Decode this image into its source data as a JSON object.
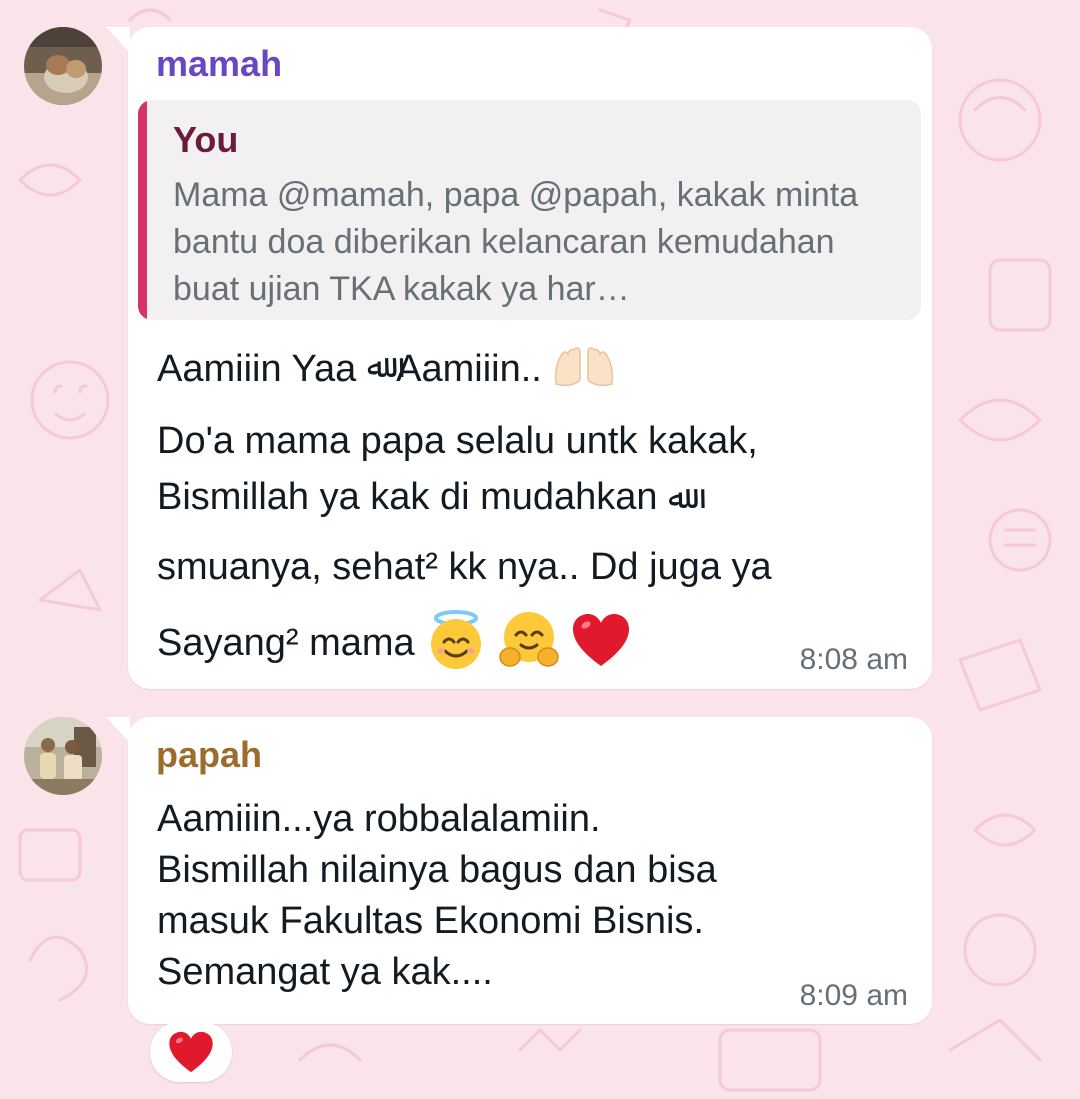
{
  "colors": {
    "wallpaper": "#fbe3ea",
    "bubble": "#ffffff",
    "mamah_name": "#6a47c2",
    "papah_name": "#9c6c2c",
    "quote_bar": "#d6336c",
    "quote_author": "#6b1c3e",
    "text": "#111b21",
    "meta": "#667077"
  },
  "messages": [
    {
      "sender": "mamah",
      "avatar": "avatar-photo",
      "quote": {
        "author": "You",
        "text": "Mama @mamah, papa @papah, kakak minta bantu doa diberikan kelancaran kemudahan buat ujian TKA kakak ya har…"
      },
      "lines": [
        {
          "text": "Aamiiin Yaa",
          "arabic": "ﷲ",
          "after": "Aamiiin..",
          "emoji": "raising-hands-icon"
        },
        {
          "text": "Do'a mama papa selalu untk kakak,"
        },
        {
          "text": "Bismillah ya kak di mudahkan",
          "arabic": "ﷲ"
        },
        {
          "text": "smuanya, sehat² kk nya.. Dd juga ya"
        },
        {
          "text": "Sayang² mama",
          "emojis": [
            "smiling-halo-icon",
            "hugging-face-icon",
            "red-heart-icon"
          ]
        }
      ],
      "time": "8:08 am"
    },
    {
      "sender": "papah",
      "avatar": "avatar-photo",
      "lines": [
        {
          "text": "Aamiiin...ya robbalalamiin."
        },
        {
          "text": "Bismillah nilainya bagus dan bisa"
        },
        {
          "text": "masuk Fakultas Ekonomi Bisnis."
        },
        {
          "text": "Semangat ya kak...."
        }
      ],
      "time": "8:09 am",
      "reaction": "red-heart-icon"
    }
  ]
}
